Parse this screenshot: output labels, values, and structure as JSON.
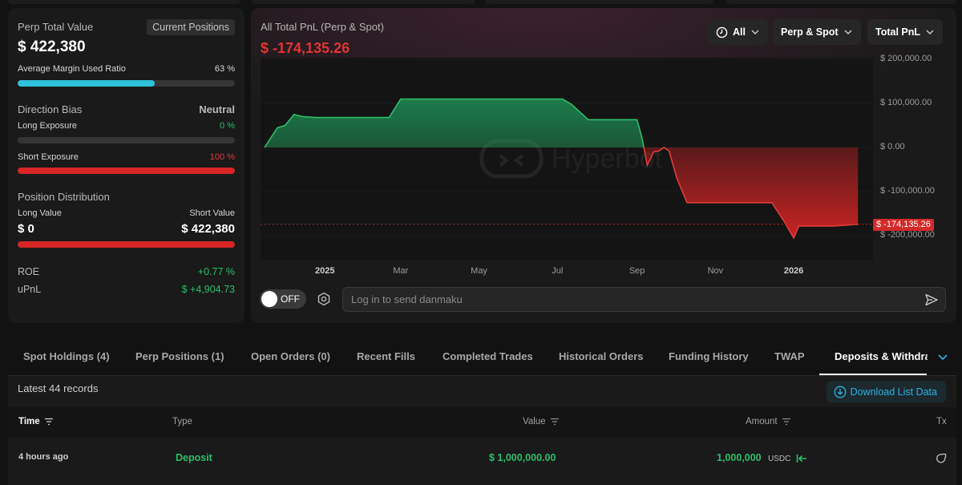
{
  "colors": {
    "green": "#2ebd6b",
    "red": "#e33b3b",
    "accent_cyan": "#2fc2dc",
    "link_blue": "#2fb1e3"
  },
  "summary": {
    "title": "Perp Total Value",
    "badge": "Current Positions",
    "total_value": "$ 422,380",
    "margin_label": "Average Margin Used Ratio",
    "margin_value": "63 %",
    "margin_ratio": 0.63,
    "direction_title": "Direction Bias",
    "direction_value": "Neutral",
    "long_exposure_label": "Long Exposure",
    "long_exposure_value": "0 %",
    "long_exposure_ratio": 0,
    "short_exposure_label": "Short Exposure",
    "short_exposure_value": "100 %",
    "short_exposure_ratio": 1.0,
    "distribution_title": "Position Distribution",
    "long_value_label": "Long Value",
    "short_value_label": "Short Value",
    "long_value": "$ 0",
    "short_value": "$ 422,380",
    "short_distribution_ratio": 1.0,
    "roe_label": "ROE",
    "roe_value": "+0.77 %",
    "upnl_label": "uPnL",
    "upnl_value": "$ +4,904.73"
  },
  "chart_panel": {
    "title": "All Total PnL (Perp & Spot)",
    "current_value": "$ -174,135.26",
    "filters": {
      "period": "All",
      "market": "Perp & Spot",
      "metric": "Total PnL"
    },
    "watermark": "Hyperbot",
    "danmaku_toggle": "OFF",
    "danmaku_placeholder": "Log in to send danmaku"
  },
  "chart_data": {
    "type": "area",
    "title": "All Total PnL (Perp & Spot)",
    "x_ticks": [
      "2025",
      "Mar",
      "May",
      "Jul",
      "Sep",
      "Nov",
      "2026"
    ],
    "y_ticks": [
      "$ 200,000.00",
      "$ 100,000.00",
      "$ 0.00",
      "$ -100,000.00",
      "$ -200,000.00"
    ],
    "ylim": [
      -250000,
      200000
    ],
    "xlim": [
      "2024-11-15",
      "2026-02-28"
    ],
    "current_label": "$ -174,135.26",
    "current_value": -174135.26,
    "series": [
      {
        "x": [
          "2024-11-15",
          "2024-11-25",
          "2024-12-01",
          "2024-12-08",
          "2024-12-15",
          "2024-12-25",
          "2025-01-05",
          "2025-02-10",
          "2025-02-20",
          "2025-03-01",
          "2025-04-15",
          "2025-05-15",
          "2025-06-15",
          "2025-07-05",
          "2025-07-12",
          "2025-07-25",
          "2025-08-10",
          "2025-08-25",
          "2025-09-01",
          "2025-09-05",
          "2025-09-09",
          "2025-09-14",
          "2025-09-18",
          "2025-09-22",
          "2025-09-26",
          "2025-10-02",
          "2025-10-10",
          "2025-10-20",
          "2025-11-15",
          "2025-12-15",
          "2025-12-25",
          "2026-01-01",
          "2026-01-05",
          "2026-01-15",
          "2026-02-01",
          "2026-02-20"
        ],
        "values": [
          0,
          45000,
          50000,
          75000,
          70000,
          68000,
          68000,
          68000,
          68000,
          110000,
          110000,
          110000,
          110000,
          110000,
          98000,
          63000,
          63000,
          63000,
          63000,
          20000,
          -40000,
          -10000,
          -8000,
          0,
          -8000,
          -70000,
          -125000,
          -125000,
          -125000,
          -125000,
          -170000,
          -205000,
          -178000,
          -178000,
          -178000,
          -174135.26
        ]
      }
    ]
  },
  "tabs": [
    "Spot Holdings (4)",
    "Perp Positions (1)",
    "Open Orders (0)",
    "Recent Fills",
    "Completed Trades",
    "Historical Orders",
    "Funding History",
    "TWAP",
    "Deposits & Withdrawals"
  ],
  "active_tab": "Deposits & Withdrawals",
  "list": {
    "records_label": "Latest 44 records",
    "download_label": "Download List Data",
    "columns": {
      "time": "Time",
      "type": "Type",
      "value": "Value",
      "amount": "Amount",
      "tx": "Tx"
    },
    "rows": [
      {
        "time": "4 hours ago",
        "type": "Deposit",
        "value": "$ 1,000,000.00",
        "amount": "1,000,000",
        "unit": "USDC"
      }
    ]
  }
}
